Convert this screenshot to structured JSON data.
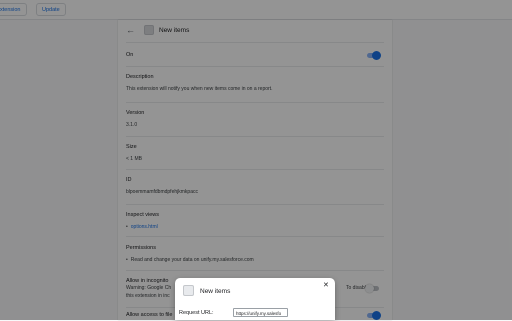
{
  "toolbar": {
    "extension_label": "xtension",
    "update_label": "Update"
  },
  "details": {
    "title": "New items",
    "on_label": "On",
    "description_label": "Description",
    "description_text": "This extension will notify you when new items come in on a report.",
    "version_label": "Version",
    "version_value": "3.1.0",
    "size_label": "Size",
    "size_value": "< 1 MB",
    "id_label": "ID",
    "id_value": "blpoemmamfdbmdpfehjkmkpacc",
    "inspect_views_label": "Inspect views",
    "inspect_views_link": "options.html",
    "permissions_label": "Permissions",
    "permission_item": "Read and change your data on unify.my.salesforce.com",
    "incognito_label": "Allow in incognito",
    "incognito_warning_start": "Warning: Google Ch",
    "incognito_warning_end": "To disable",
    "incognito_warning_line2": "this extension in inc",
    "file_access_label": "Allow access to file"
  },
  "dialog": {
    "title": "New items",
    "request_url_label": "Request URL:",
    "request_url_value": "https://unify.my.salesfo"
  },
  "colors": {
    "accent": "#1a73e8",
    "overlay": "rgba(0,0,0,0.42)"
  }
}
